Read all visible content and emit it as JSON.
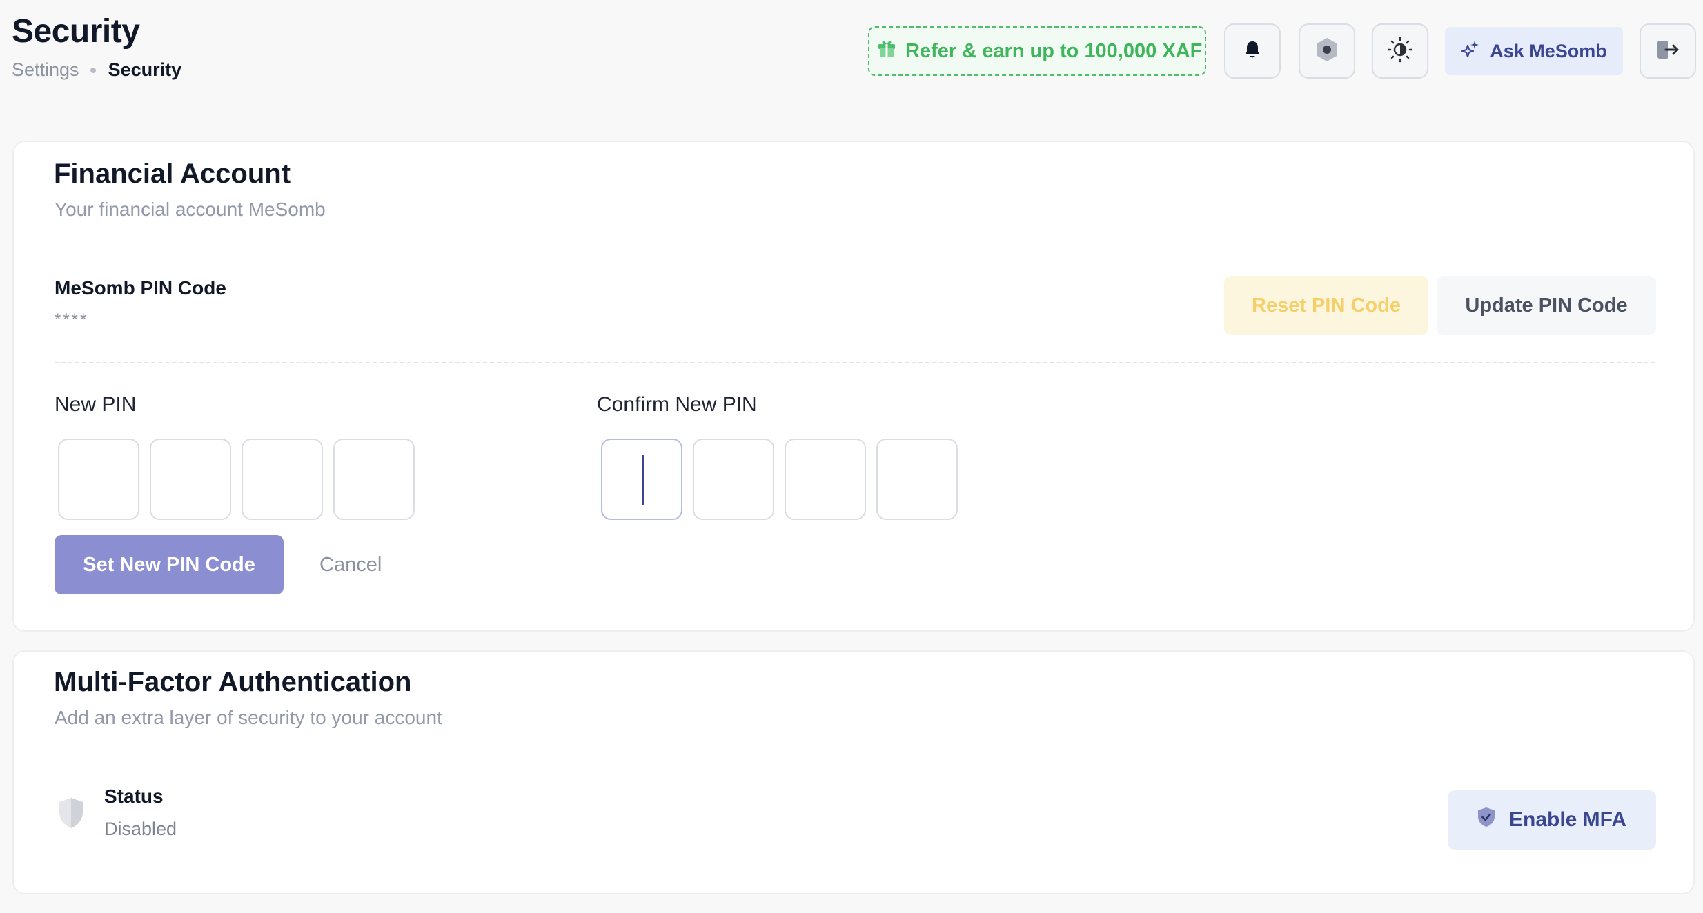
{
  "header": {
    "title": "Security",
    "breadcrumb": {
      "parent": "Settings",
      "current": "Security"
    },
    "refer": {
      "label": "Refer & earn up to 100,000 XAF",
      "icon": "gift-icon",
      "color": "#3fb55c"
    },
    "icons": [
      "bell-icon",
      "hexagon-icon",
      "sun-icon",
      "logout-icon"
    ],
    "ask_button": {
      "label": "Ask MeSomb",
      "icon": "sparkles-icon"
    }
  },
  "financial": {
    "title": "Financial Account",
    "subtitle": "Your financial account MeSomb",
    "pin_label": "MeSomb PIN Code",
    "pin_mask": "****",
    "reset_button": "Reset PIN Code",
    "update_button": "Update PIN Code",
    "new_pin_label": "New PIN",
    "confirm_pin_label": "Confirm New PIN",
    "new_pin_digits": [
      "",
      "",
      "",
      ""
    ],
    "confirm_pin_digits": [
      "",
      "",
      "",
      ""
    ],
    "set_button": "Set New PIN Code",
    "cancel_button": "Cancel"
  },
  "mfa": {
    "title": "Multi-Factor Authentication",
    "subtitle": "Add an extra layer of security to your account",
    "status_label": "Status",
    "status_value": "Disabled",
    "enable_button": "Enable MFA",
    "button_icon": "shield-check-icon"
  },
  "colors": {
    "accent": "#3b4690",
    "primary_button": "#8b8fd2",
    "warning_soft": "#fdf6df",
    "success": "#3fb55c"
  }
}
